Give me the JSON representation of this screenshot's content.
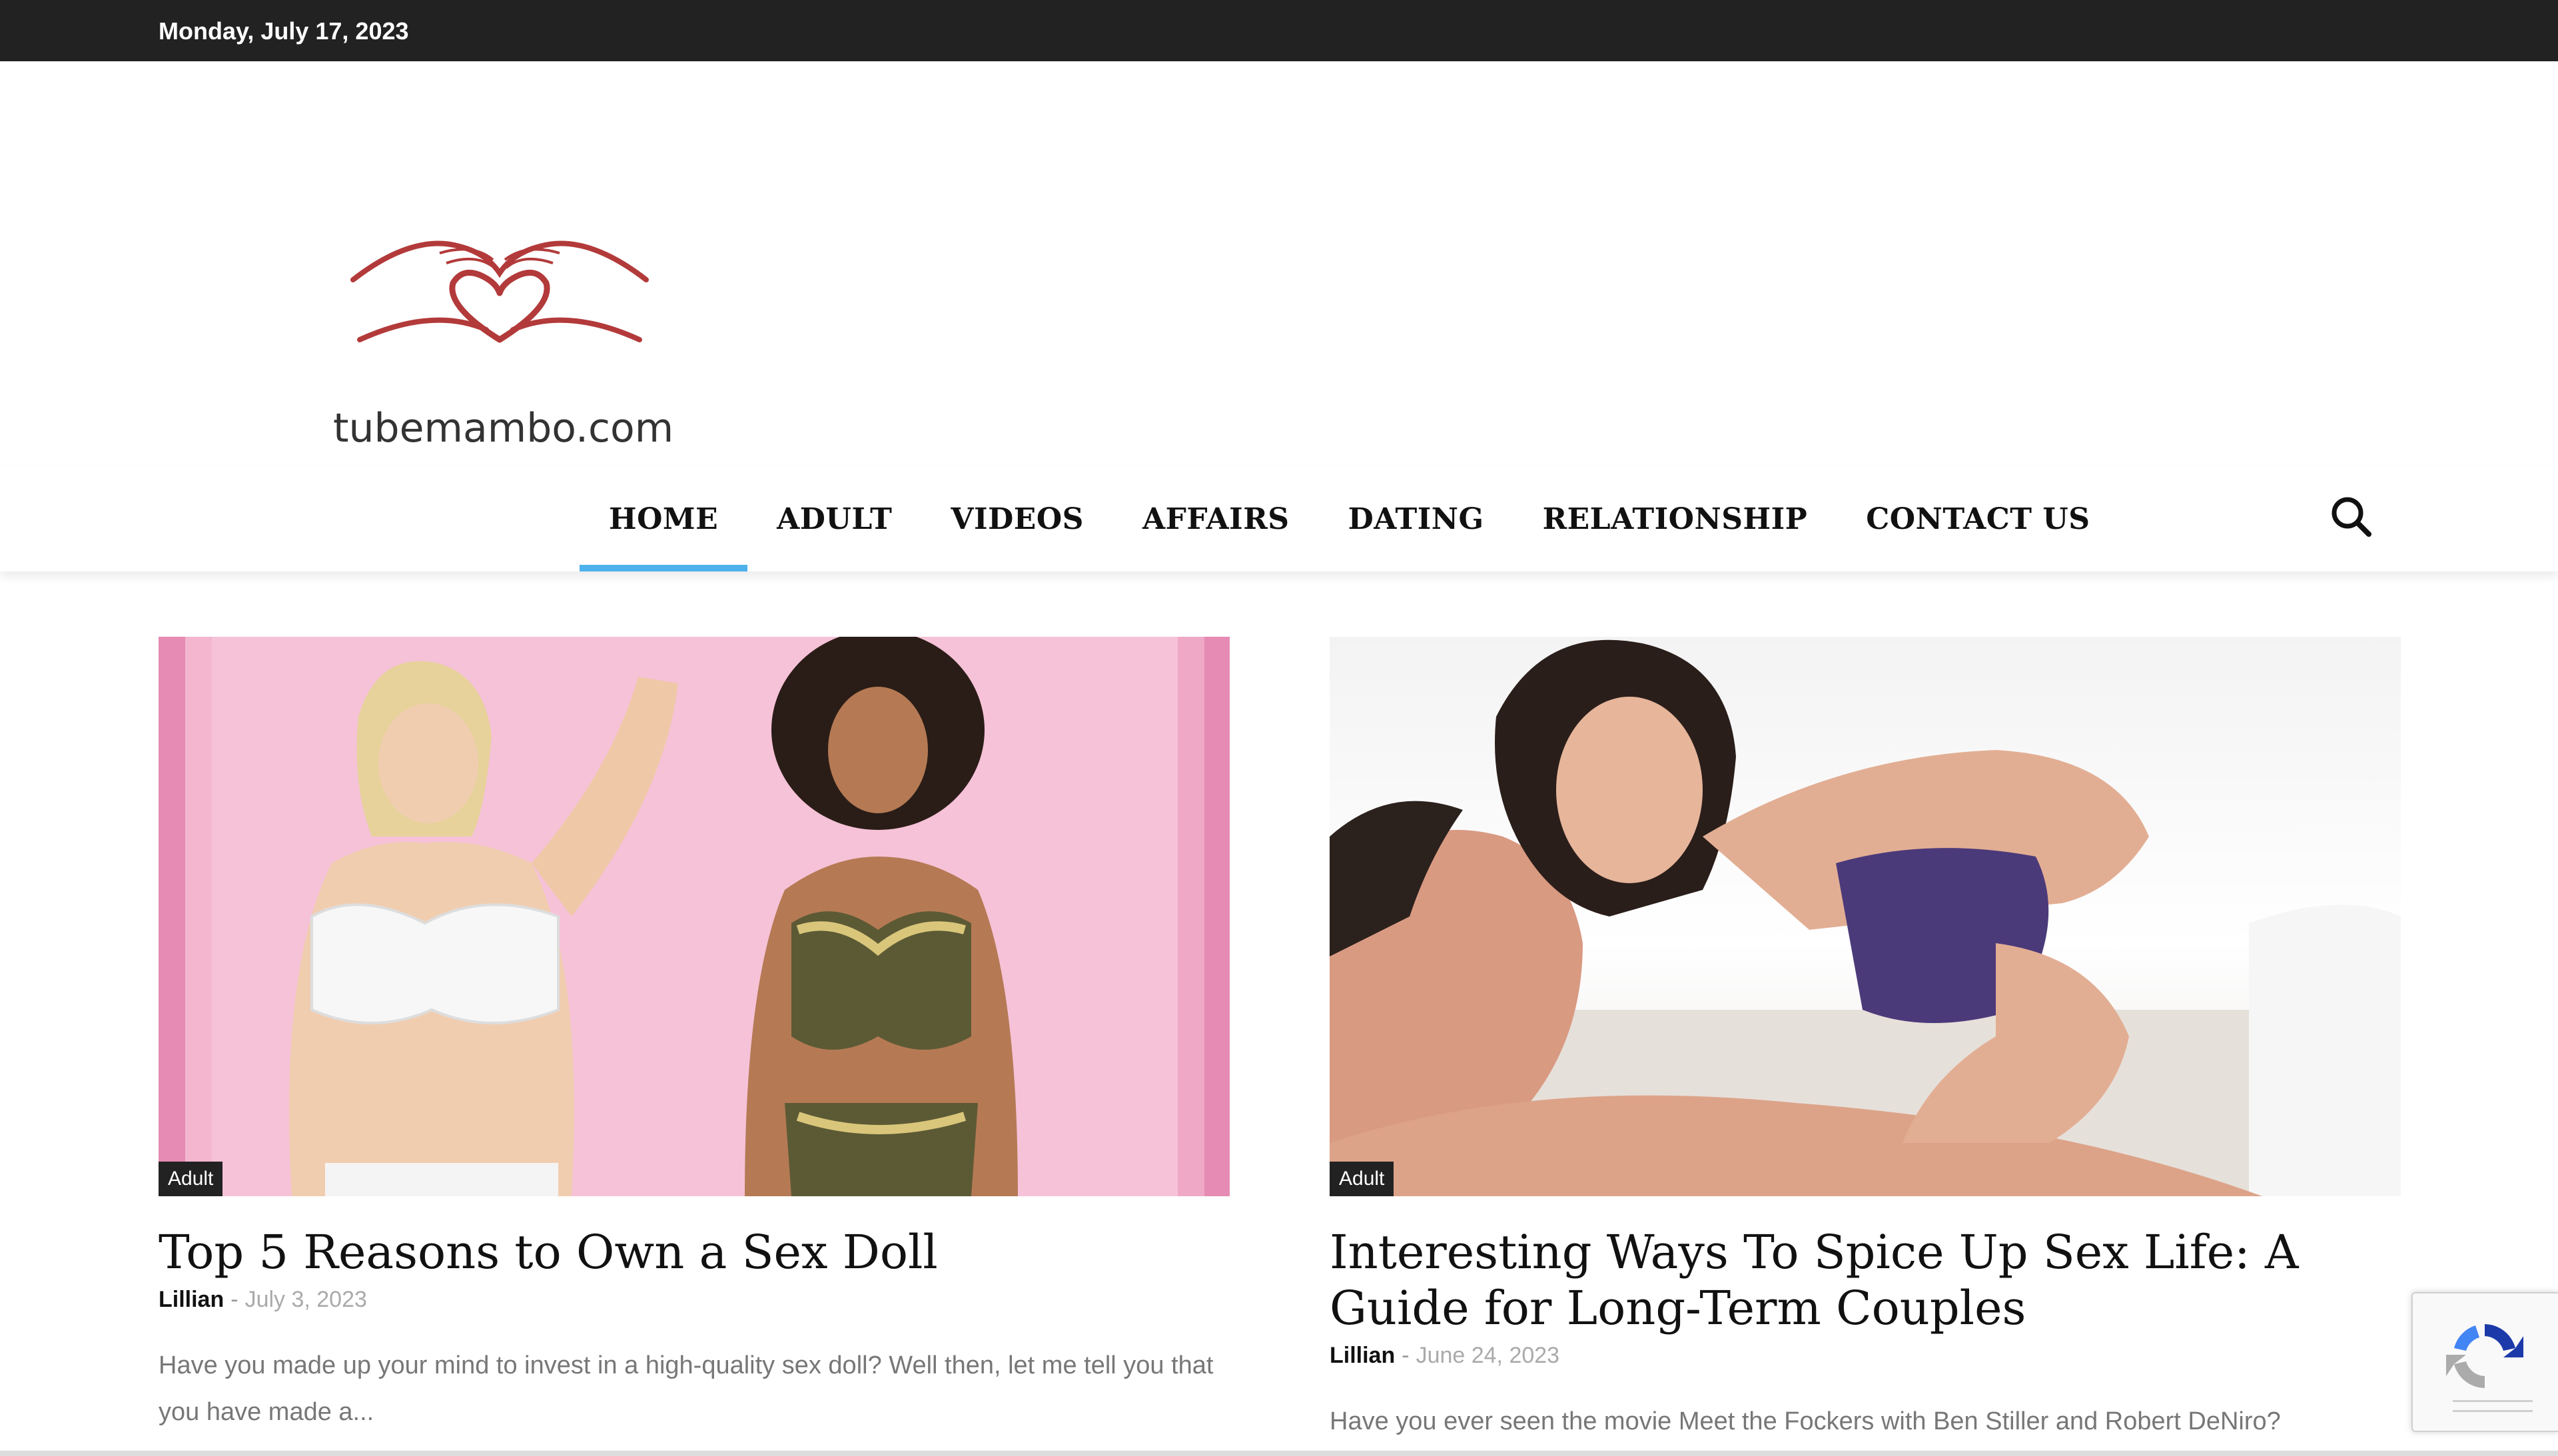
{
  "topbar": {
    "date": "Monday, July 17, 2023"
  },
  "brand": {
    "logo_text": "tubemambo.com",
    "logo_color": "#b33a3a"
  },
  "nav": {
    "items": [
      {
        "label": "HOME",
        "active": true
      },
      {
        "label": "ADULT",
        "active": false
      },
      {
        "label": "VIDEOS",
        "active": false
      },
      {
        "label": "AFFAIRS",
        "active": false
      },
      {
        "label": "DATING",
        "active": false
      },
      {
        "label": "RELATIONSHIP",
        "active": false
      },
      {
        "label": "CONTACT US",
        "active": false
      }
    ],
    "active_color": "#4db2ec",
    "search_icon": "search-icon"
  },
  "articles": [
    {
      "category": "Adult",
      "title": "Top 5 Reasons to Own a Sex Doll",
      "author": "Lillian",
      "separator": "-",
      "date": "July 3, 2023",
      "excerpt": "Have you made up your mind to invest in a high-quality sex doll? Well then, let me tell you that you have made a..."
    },
    {
      "category": "Adult",
      "title": "Interesting Ways To Spice Up Sex Life: A Guide for Long-Term Couples",
      "author": "Lillian",
      "separator": "-",
      "date": "June 24, 2023",
      "excerpt": "Have you ever seen the movie Meet the Fockers with Ben Stiller and Robert DeNiro?"
    }
  ],
  "recaptcha": {
    "icon": "recaptcha-icon"
  }
}
